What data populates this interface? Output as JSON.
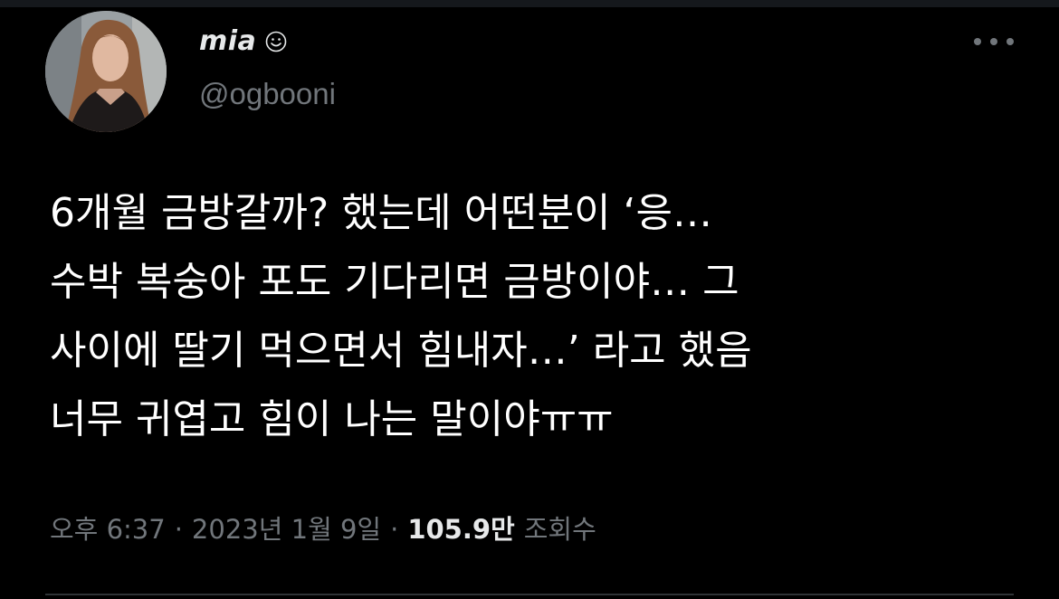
{
  "author": {
    "display_name": "mia",
    "handle": "@ogbooni",
    "name_emoji_icon": "smiling-face-icon",
    "avatar_icon": "profile-photo"
  },
  "menu": {
    "icon": "more-horizontal-icon"
  },
  "tweet": {
    "lines": [
      "6개월 금방갈까? 했는데 어떤분이 ‘응…",
      "수박 복숭아 포도 기다리면 금방이야… 그",
      "사이에 딸기 먹으면서 힘내자…’ 라고 했음",
      "너무 귀엽고 힘이 나는 말이야ㅠㅠ"
    ]
  },
  "meta": {
    "time": "오후 6:37",
    "separator": "·",
    "date": "2023년 1월 9일",
    "views_count": "105.9만",
    "views_label": "조회수"
  },
  "colors": {
    "background": "#000000",
    "primary_text": "#e7e9ea",
    "secondary_text": "#71767b",
    "divider": "#2f3336"
  }
}
